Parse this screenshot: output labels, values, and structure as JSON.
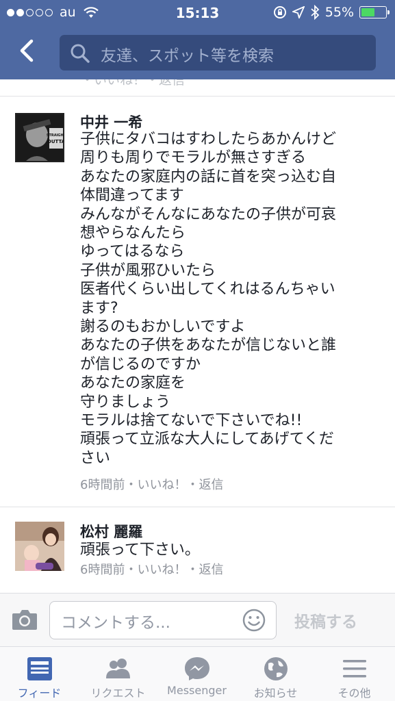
{
  "status_bar": {
    "carrier": "au",
    "time": "15:13",
    "battery_percent": "55%",
    "battery_level": 0.55,
    "signal_bars_filled": 2,
    "signal_bars_total": 5
  },
  "header": {
    "back_icon": "chevron-left-icon",
    "search_placeholder": "友達、スポット等を検索",
    "color": "#4e69a2"
  },
  "partial_row_text": "・いいね！・返信",
  "comments": [
    {
      "author": "中井 一希",
      "lines": [
        "子供にタバコはすわしたらあかんけど",
        "周りも周りでモラルが無さすぎる",
        "あなたの家庭内の話に首を突っ込む自",
        "体間違ってます",
        "みんながそんなにあなたの子供が可哀",
        "想やらなんたら",
        "ゆってはるなら",
        "子供が風邪ひいたら",
        "医者代くらい出してくれはるんちゃい",
        "ます?",
        "謝るのもおかしいですよ",
        "あなたの子供をあなたが信じないと誰",
        "が信じるのですか",
        "あなたの家庭を",
        "守りましょう",
        "モラルは捨てないで下さいでね!!",
        "頑張って立派な大人にしてあげてくだ",
        "さい"
      ],
      "meta": "6時間前・いいね！・返信",
      "avatar_text": "STRAIGHT OUTTA"
    },
    {
      "author": "松村 麗羅",
      "lines": [
        "頑張って下さい。"
      ],
      "meta": "6時間前・いいね！・返信"
    }
  ],
  "compose": {
    "placeholder": "コメントする...",
    "post_label": "投稿する",
    "camera_icon": "camera-icon",
    "smiley_icon": "smiley-icon"
  },
  "tabs": [
    {
      "label": "フィード",
      "icon": "feed-icon",
      "active": true
    },
    {
      "label": "リクエスト",
      "icon": "friend-requests-icon",
      "active": false
    },
    {
      "label": "Messenger",
      "icon": "messenger-icon",
      "active": false
    },
    {
      "label": "お知らせ",
      "icon": "globe-icon",
      "active": false
    },
    {
      "label": "その他",
      "icon": "menu-icon",
      "active": false
    }
  ],
  "colors": {
    "accent": "#4267b2",
    "inactive_tab": "#9197a3",
    "meta_text": "#90949c"
  }
}
